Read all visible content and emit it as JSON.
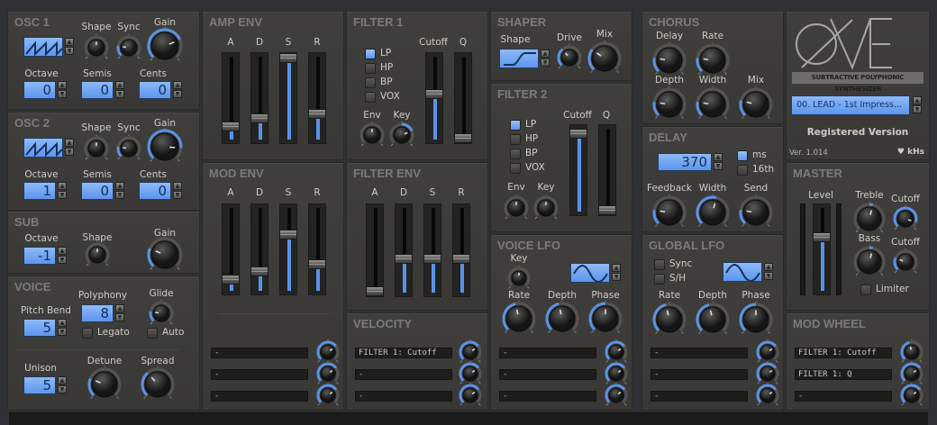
{
  "osc1": {
    "title": "OSC 1",
    "shape_label": "Shape",
    "sync_label": "Sync",
    "gain_label": "Gain",
    "octave_label": "Octave",
    "semis_label": "Semis",
    "cents_label": "Cents",
    "waveform": "saw",
    "octave": "0",
    "semis": "0",
    "cents": "0",
    "shape": 0.5,
    "sync": 0.2,
    "gain": 0.75
  },
  "osc2": {
    "title": "OSC 2",
    "shape_label": "Shape",
    "sync_label": "Sync",
    "gain_label": "Gain",
    "octave_label": "Octave",
    "semis_label": "Semis",
    "cents_label": "Cents",
    "waveform": "saw",
    "octave": "1",
    "semis": "0",
    "cents": "0",
    "shape": 0.5,
    "sync": 0.2,
    "gain": 0.85
  },
  "sub": {
    "title": "SUB",
    "octave_label": "Octave",
    "shape_label": "Shape",
    "gain_label": "Gain",
    "octave": "-1",
    "shape": 0.5,
    "gain": 0.25
  },
  "voice": {
    "title": "VOICE",
    "pitch_bend_label": "Pitch Bend",
    "pitch_bend": "5",
    "polyphony_label": "Polyphony",
    "polyphony": "8",
    "glide_label": "Glide",
    "glide": 0.2,
    "legato_label": "Legato",
    "legato": false,
    "auto_label": "Auto",
    "auto": false,
    "unison_label": "Unison",
    "unison": "5",
    "detune_label": "Detune",
    "detune": 0.25,
    "spread_label": "Spread",
    "spread": 0.35
  },
  "amp_env": {
    "title": "AMP ENV",
    "labels": [
      "A",
      "D",
      "S",
      "R"
    ],
    "values": [
      0.15,
      0.25,
      1.0,
      0.3
    ]
  },
  "mod_env": {
    "title": "MOD ENV",
    "labels": [
      "A",
      "D",
      "S",
      "R"
    ],
    "values": [
      0.12,
      0.22,
      0.68,
      0.32
    ],
    "slots": [
      "-",
      "-",
      "-"
    ],
    "amounts": [
      0.7,
      0.7,
      0.7
    ]
  },
  "filter1": {
    "title": "FILTER 1",
    "types": [
      "LP",
      "HP",
      "BP",
      "VOX"
    ],
    "selected": "LP",
    "cutoff_label": "Cutoff",
    "q_label": "Q",
    "cutoff": 0.55,
    "q": 0.0,
    "env_label": "Env",
    "key_label": "Key",
    "env": 0.5,
    "key": 0.75
  },
  "filter_env": {
    "title": "FILTER ENV",
    "labels": [
      "A",
      "D",
      "S",
      "R"
    ],
    "values": [
      0.0,
      0.4,
      0.4,
      0.4
    ]
  },
  "velocity": {
    "title": "VELOCITY",
    "slots": [
      "FILTER 1: Cutoff",
      "-",
      "-"
    ],
    "amounts": [
      0.7,
      0.7,
      0.7
    ]
  },
  "shaper": {
    "title": "SHAPER",
    "shape_label": "Shape",
    "drive_label": "Drive",
    "mix_label": "Mix",
    "waveform": "s-curve",
    "drive": 0.35,
    "mix": 0.3
  },
  "filter2": {
    "title": "FILTER 2",
    "types": [
      "LP",
      "HP",
      "BP",
      "VOX"
    ],
    "selected": "LP",
    "cutoff_label": "Cutoff",
    "q_label": "Q",
    "cutoff": 0.95,
    "q": 0.0,
    "env_label": "Env",
    "key_label": "Key",
    "env": 0.5,
    "key": 0.5
  },
  "voice_lfo": {
    "title": "VOICE LFO",
    "key_label": "Key",
    "key": 0.5,
    "waveform": "sine",
    "rate_label": "Rate",
    "depth_label": "Depth",
    "phase_label": "Phase",
    "rate": 0.45,
    "depth": 0.45,
    "phase": 0.5,
    "slots": [
      "-",
      "-",
      "-"
    ],
    "amounts": [
      0.7,
      0.7,
      0.7
    ]
  },
  "chorus": {
    "title": "CHORUS",
    "delay_label": "Delay",
    "rate_label": "Rate",
    "depth_label": "Depth",
    "width_label": "Width",
    "mix_label": "Mix",
    "delay": 0.2,
    "rate": 0.2,
    "depth": 0.2,
    "width": 0.2,
    "mix": 0.22
  },
  "delay": {
    "title": "DELAY",
    "time": "370",
    "ms_label": "ms",
    "ms": true,
    "sixteenth_label": "16th",
    "sixteenth": false,
    "feedback_label": "Feedback",
    "width_label": "Width",
    "send_label": "Send",
    "feedback": 0.2,
    "width": 0.55,
    "send": 0.2
  },
  "global_lfo": {
    "title": "GLOBAL LFO",
    "sync_label": "Sync",
    "sync": false,
    "sh_label": "S/H",
    "sh": false,
    "waveform": "sine",
    "rate_label": "Rate",
    "depth_label": "Depth",
    "phase_label": "Phase",
    "rate": 0.45,
    "depth": 0.45,
    "phase": 0.5,
    "slots": [
      "-",
      "-",
      "-"
    ],
    "amounts": [
      0.7,
      0.7,
      0.7
    ]
  },
  "brand": {
    "logo": "ONE",
    "subtitle": "SUBTRACTIVE POLYPHONIC SYNTHESIZER",
    "preset": "00. LEAD - 1st Impress...",
    "registered": "Registered Version",
    "version": "Ver. 1.014",
    "vendor": "♥ kHs"
  },
  "master": {
    "title": "MASTER",
    "level_label": "Level",
    "level": 0.65,
    "treble_label": "Treble",
    "treble": 0.55,
    "treble_cutoff_label": "Cutoff",
    "treble_cutoff": 0.9,
    "bass_label": "Bass",
    "bass": 0.55,
    "bass_cutoff_label": "Cutoff",
    "bass_cutoff": 0.25,
    "limiter_label": "Limiter",
    "limiter": false
  },
  "mod_wheel": {
    "title": "MOD WHEEL",
    "slots": [
      "FILTER 1: Cutoff",
      "FILTER 1: Q",
      "-"
    ],
    "amounts": [
      0.45,
      0.7,
      0.7
    ]
  },
  "colors": {
    "accent": "#5a93e6",
    "lcd": "#6aa2f0",
    "panel": "#3c3b39"
  }
}
